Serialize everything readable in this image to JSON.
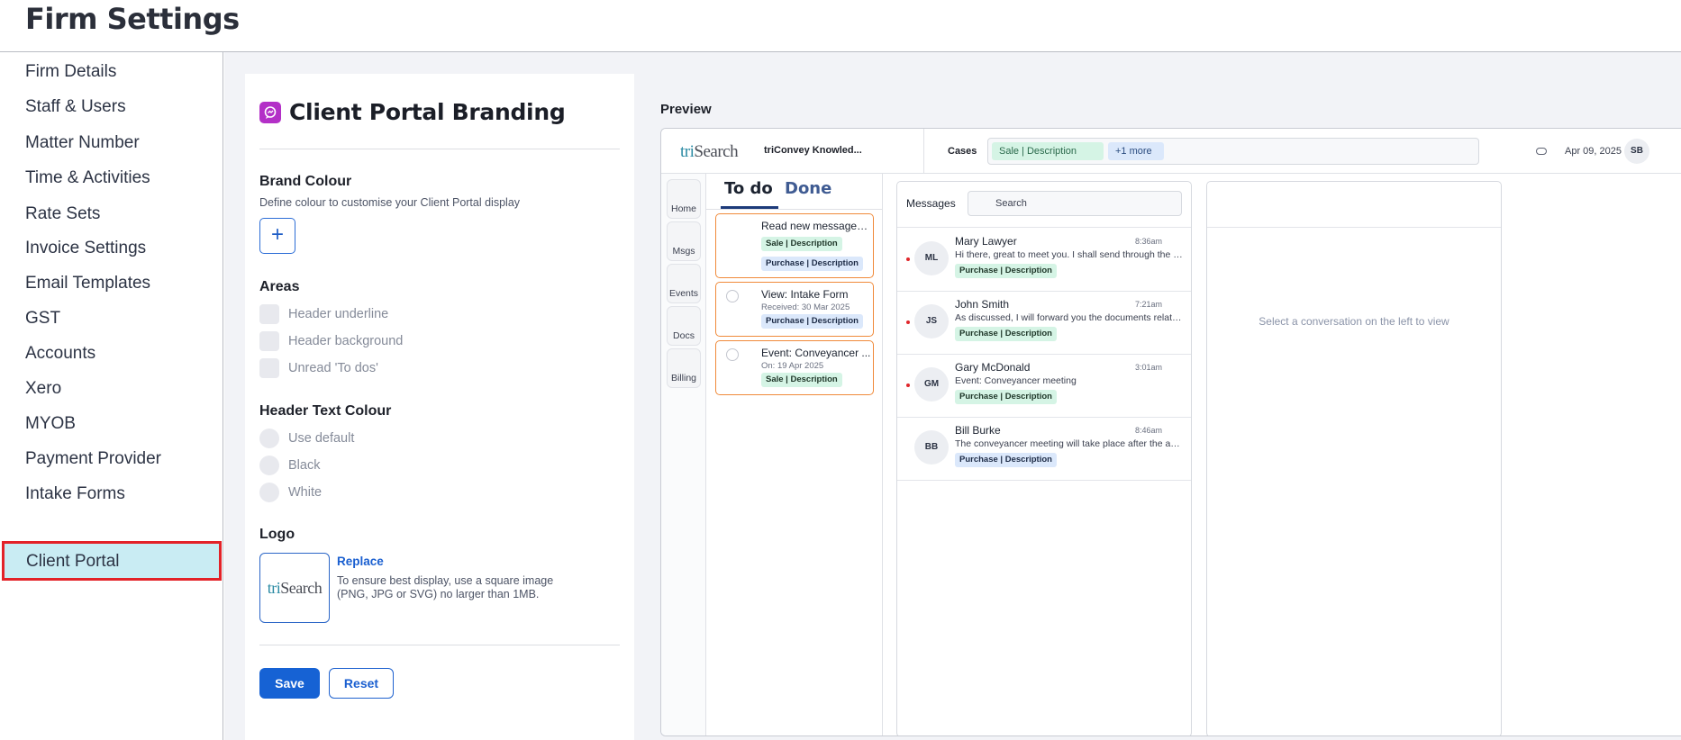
{
  "app": {
    "title": "Firm Settings"
  },
  "sidebar": {
    "items": [
      {
        "label": "Firm Details"
      },
      {
        "label": "Staff & Users"
      },
      {
        "label": "Matter Number"
      },
      {
        "label": "Time & Activities"
      },
      {
        "label": "Rate Sets"
      },
      {
        "label": "Invoice Settings"
      },
      {
        "label": "Email Templates"
      },
      {
        "label": "GST"
      },
      {
        "label": "Accounts"
      },
      {
        "label": "Xero"
      },
      {
        "label": "MYOB"
      },
      {
        "label": "Payment Provider"
      },
      {
        "label": "Intake Forms"
      },
      {
        "label": "Client Portal"
      }
    ],
    "active_item": "Client Portal",
    "active_highlight_color": "#c9ecf3"
  },
  "branding": {
    "title": "Client Portal Branding",
    "icon": "chat-bubble-icon",
    "brand_colour": {
      "title": "Brand Colour",
      "description": "Define colour to customise your Client Portal display",
      "add_button": "+"
    },
    "areas": {
      "title": "Areas",
      "options": [
        {
          "label": "Header underline",
          "checked": false
        },
        {
          "label": "Header background",
          "checked": false
        },
        {
          "label": "Unread 'To dos'",
          "checked": false
        }
      ]
    },
    "header_text_colour": {
      "title": "Header Text Colour",
      "options": [
        {
          "label": "Use default"
        },
        {
          "label": "Black"
        },
        {
          "label": "White"
        }
      ]
    },
    "logo": {
      "title": "Logo",
      "logo_text_prefix": "tri",
      "logo_text_suffix": "Search",
      "replace_label": "Replace",
      "hint": "To ensure best display, use a square image (PNG, JPG or SVG) no larger than 1MB."
    },
    "actions": {
      "save": "Save",
      "reset": "Reset"
    },
    "accent_color": "#1662d4"
  },
  "preview": {
    "label": "Preview",
    "header": {
      "logo_prefix": "tri",
      "logo_suffix": "Search",
      "firm_name": "triConvey Knowled...",
      "cases_label": "Cases",
      "case_chip": "Sale | Description",
      "more_chip": "+1 more",
      "date": "Apr 09, 2025",
      "user_initials": "SB"
    },
    "rail": [
      "Home",
      "Msgs",
      "Events",
      "Docs",
      "Billing"
    ],
    "todo": {
      "tab_todo": "To do",
      "tab_done": "Done",
      "items": [
        {
          "title": "Read new messages ...",
          "tags": [
            "Sale | Description",
            "Purchase | Description"
          ]
        },
        {
          "title": "View: Intake Form",
          "sub": "Received: 30 Mar 2025",
          "tags": [
            "Purchase | Description"
          ]
        },
        {
          "title": "Event: Conveyancer ...",
          "sub": "On: 19 Apr 2025",
          "tags": [
            "Sale | Description"
          ]
        }
      ],
      "card_border_color": "#f08a3a"
    },
    "messages": {
      "title": "Messages",
      "search_placeholder": "Search",
      "items": [
        {
          "initials": "ML",
          "name": "Mary Lawyer",
          "time": "8:36am",
          "text": "Hi there, great to meet you. I shall send through the con...",
          "tag": "Purchase | Description",
          "unread": true
        },
        {
          "initials": "JS",
          "name": "John Smith",
          "time": "7:21am",
          "text": "As discussed, I will forward you the documents related t...",
          "tag": "Purchase | Description",
          "unread": true
        },
        {
          "initials": "GM",
          "name": "Gary McDonald",
          "time": "3:01am",
          "text": "Event: Conveyancer meeting",
          "tag": "Purchase | Description",
          "unread": true
        },
        {
          "initials": "BB",
          "name": "Bill Burke",
          "time": "8:46am",
          "text": "The conveyancer meeting will take place after the aucti...",
          "tag": "Purchase | Description",
          "unread": false
        }
      ]
    },
    "conversation": {
      "empty_text": "Select a conversation on the left to view"
    }
  }
}
